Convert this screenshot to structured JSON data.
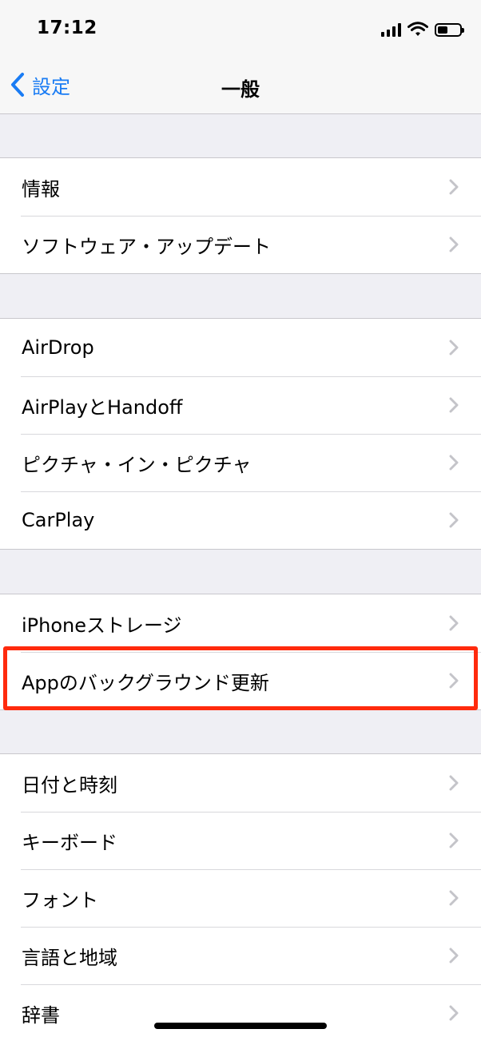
{
  "status_bar": {
    "time": "17:12"
  },
  "nav": {
    "back_label": "設定",
    "title": "一般"
  },
  "groups": [
    {
      "items": [
        "情報",
        "ソフトウェア・アップデート"
      ]
    },
    {
      "items": [
        "AirDrop",
        "AirPlayとHandoff",
        "ピクチャ・イン・ピクチャ",
        "CarPlay"
      ]
    },
    {
      "items": [
        "iPhoneストレージ",
        "Appのバックグラウンド更新"
      ]
    },
    {
      "items": [
        "日付と時刻",
        "キーボード",
        "フォント",
        "言語と地域",
        "辞書"
      ]
    }
  ],
  "colors": {
    "accent": "#1a7cf4",
    "highlight": "#ff2a0d",
    "background": "#efeff4"
  },
  "highlighted_item": "Appのバックグラウンド更新"
}
